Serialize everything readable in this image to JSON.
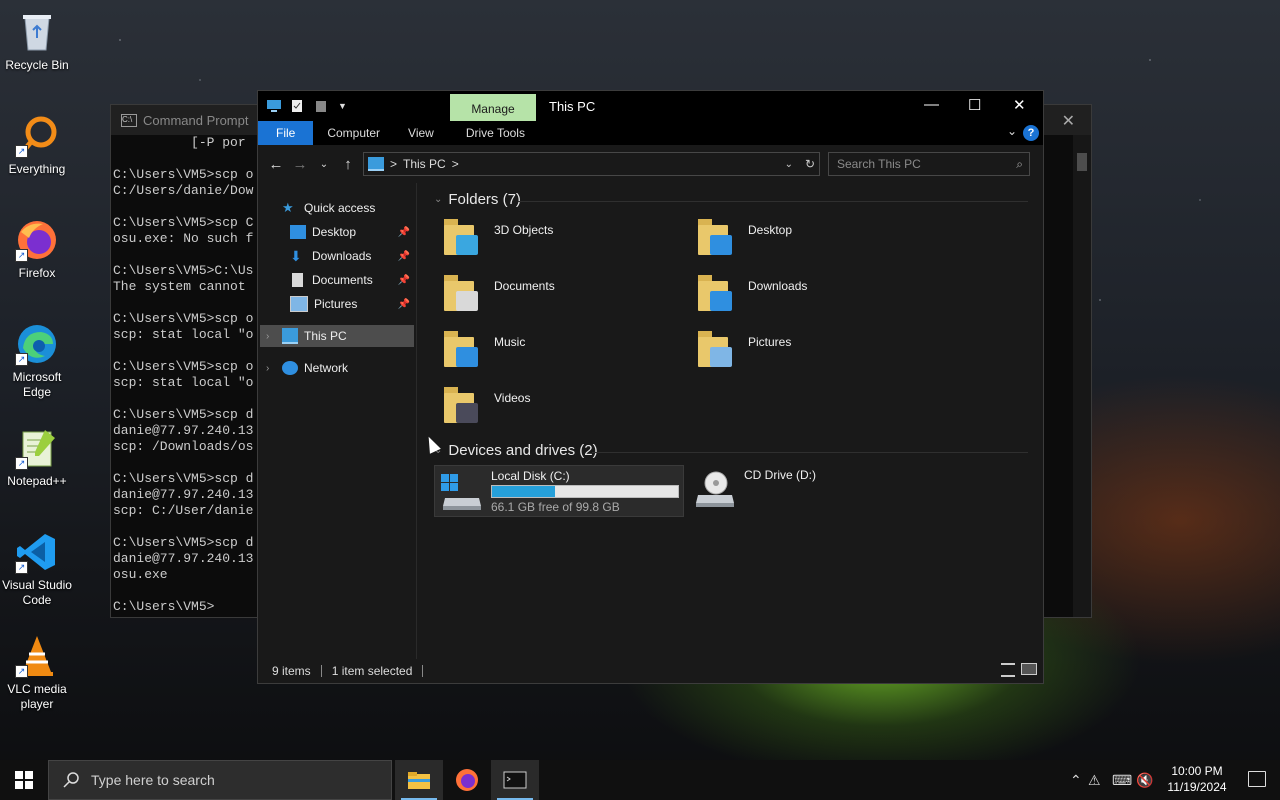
{
  "desktop": {
    "icons": [
      {
        "label": "Recycle Bin",
        "icon": "recycle-bin-icon"
      },
      {
        "label": "Everything",
        "icon": "everything-search-icon"
      },
      {
        "label": "Firefox",
        "icon": "firefox-icon"
      },
      {
        "label": "Microsoft Edge",
        "icon": "edge-icon"
      },
      {
        "label": "Notepad++",
        "icon": "notepadpp-icon"
      },
      {
        "label": "Visual Studio Code",
        "icon": "vscode-icon"
      },
      {
        "label": "VLC media player",
        "icon": "vlc-icon"
      }
    ]
  },
  "cmd": {
    "title": "Command Prompt",
    "lines": [
      "          [-P por",
      "",
      "C:\\Users\\VM5>scp o",
      "C:/Users/danie/Dow",
      "",
      "C:\\Users\\VM5>scp C",
      "osu.exe: No such f",
      "",
      "C:\\Users\\VM5>C:\\Us",
      "The system cannot ",
      "",
      "C:\\Users\\VM5>scp o",
      "scp: stat local \"o",
      "",
      "C:\\Users\\VM5>scp o",
      "scp: stat local \"o",
      "",
      "C:\\Users\\VM5>scp d",
      "danie@77.97.240.13",
      "scp: /Downloads/os",
      "",
      "C:\\Users\\VM5>scp d",
      "danie@77.97.240.13",
      "scp: C:/User/danie",
      "",
      "C:\\Users\\VM5>scp d",
      "danie@77.97.240.13",
      "osu.exe",
      "",
      "C:\\Users\\VM5>"
    ]
  },
  "explorer": {
    "title": "This PC",
    "manage_tab": "Manage",
    "ribbon_tabs": {
      "file": "File",
      "computer": "Computer",
      "view": "View",
      "drive_tools": "Drive Tools"
    },
    "address": {
      "crumb": "This PC",
      "sep": ">"
    },
    "search_placeholder": "Search This PC",
    "nav": {
      "quick_access": "Quick access",
      "desktop": "Desktop",
      "downloads": "Downloads",
      "documents": "Documents",
      "pictures": "Pictures",
      "this_pc": "This PC",
      "network": "Network"
    },
    "folders_header": "Folders (7)",
    "folders": [
      {
        "name": "3D Objects",
        "accent": "#3aa7e0"
      },
      {
        "name": "Desktop",
        "accent": "#2f8fe0"
      },
      {
        "name": "Documents",
        "accent": "#d9d9d9"
      },
      {
        "name": "Downloads",
        "accent": "#2f8fe0"
      },
      {
        "name": "Music",
        "accent": "#2f8fe0"
      },
      {
        "name": "Pictures",
        "accent": "#7fb6e6"
      },
      {
        "name": "Videos",
        "accent": "#4a4a5a"
      }
    ],
    "drives_header": "Devices and drives (2)",
    "drives": {
      "c": {
        "name": "Local Disk (C:)",
        "free": "66.1 GB free of 99.8 GB",
        "used_fraction": 0.338
      },
      "d": {
        "name": "CD Drive (D:)"
      }
    },
    "status": {
      "items": "9 items",
      "selected": "1 item selected"
    }
  },
  "taskbar": {
    "search_placeholder": "Type here to search",
    "time": "10:00 PM",
    "date": "11/19/2024"
  },
  "colors": {
    "accent": "#1a73d4",
    "manage_tab": "#b6e3a8",
    "drive_fill": "#26a0da"
  }
}
